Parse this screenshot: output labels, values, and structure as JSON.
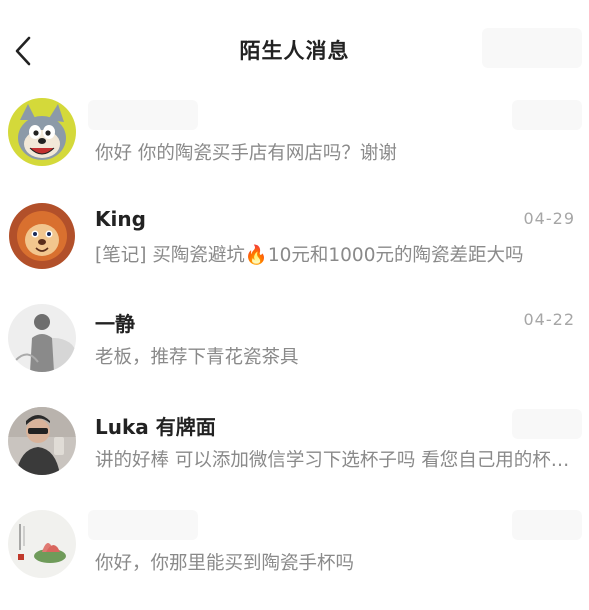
{
  "header": {
    "title": "陌生人消息"
  },
  "conversations": [
    {
      "name": "",
      "date": "",
      "preview": "你好 你的陶瓷买手店有网店吗？谢谢",
      "avatar_icon": "cartoon-cat-avatar-icon"
    },
    {
      "name": "King",
      "date": "04-29",
      "preview": "[笔记] 买陶瓷避坑🔥10元和1000元的陶瓷差距大吗",
      "avatar_icon": "cartoon-lion-avatar-icon"
    },
    {
      "name": "一静",
      "date": "04-22",
      "preview": "老板，推荐下青花瓷茶具",
      "avatar_icon": "person-photo-avatar-icon"
    },
    {
      "name": "Luka 有牌面",
      "date": "",
      "preview": "讲的好棒 可以添加微信学习下选杯子吗 看您自己用的杯子很好看",
      "avatar_icon": "selfie-photo-avatar-icon"
    },
    {
      "name": "",
      "date": "",
      "preview": "你好，你那里能买到陶瓷手杯吗",
      "avatar_icon": "lotus-painting-avatar-icon"
    }
  ]
}
